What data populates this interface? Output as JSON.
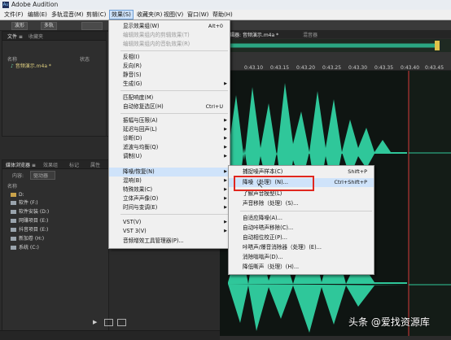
{
  "window": {
    "title": "Adobe Audition",
    "app_icon": "Au"
  },
  "menubar": [
    "文件(F)",
    "编辑(E)",
    "多轨混音(M)",
    "剪辑(C)",
    "效果(S)",
    "收藏夹(R)",
    "视图(V)",
    "窗口(W)",
    "帮助(H)"
  ],
  "toolbar": {
    "waveform": "波形",
    "multitrack": "多轨"
  },
  "files_panel": {
    "tabs": [
      "文件 ≡",
      "收藏夹"
    ],
    "columns": {
      "name": "名称",
      "status": "状态",
      "duration": "持续时间"
    },
    "items": [
      "音频演示.m4a *"
    ]
  },
  "media_panel": {
    "tabs": [
      "媒体浏览器 ≡",
      "效果组",
      "标记",
      "属性"
    ],
    "content_label": "内容:",
    "content_value": "驱动器",
    "name_col": "名称",
    "drives": [
      "D:",
      "软件 (F:)",
      "软件安装 (D:)",
      "网赚项目 (E:)",
      "抖音项目 (E:)",
      "新加卷 (H:)",
      "系统 (C:)"
    ]
  },
  "editor": {
    "tab": "编辑器: 音频演示.m4a *",
    "tab2": "混音器"
  },
  "ruler": [
    "0:43.10",
    "0:43.15",
    "0:43.20",
    "0:43.25",
    "0:43.30",
    "0:43.35",
    "0:43.40",
    "0:43.45"
  ],
  "effects_menu": {
    "items": [
      {
        "label": "显示效果组(W)",
        "shortcut": "Alt+0"
      },
      {
        "label": "编辑效果组内的剪辑效果(T)",
        "disabled": true
      },
      {
        "label": "编辑效果组内的音轨效果(R)",
        "disabled": true
      },
      {
        "label": "反相(I)"
      },
      {
        "label": "反向(R)"
      },
      {
        "label": "静音(S)"
      },
      {
        "label": "生成(G)",
        "arrow": true
      },
      {
        "label": "匹配响度(M)"
      },
      {
        "label": "自动修复选区(H)",
        "shortcut": "Ctrl+U"
      },
      {
        "label": "振幅与压限(A)",
        "arrow": true
      },
      {
        "label": "延迟与回声(L)",
        "arrow": true
      },
      {
        "label": "诊断(D)",
        "arrow": true
      },
      {
        "label": "滤波与均衡(Q)",
        "arrow": true
      },
      {
        "label": "调制(U)",
        "arrow": true
      },
      {
        "label": "降噪/恢复(N)",
        "arrow": true,
        "highlight": true
      },
      {
        "label": "混响(B)",
        "arrow": true
      },
      {
        "label": "特殊效果(C)",
        "arrow": true
      },
      {
        "label": "立体声声像(O)",
        "arrow": true
      },
      {
        "label": "时间与变调(E)",
        "arrow": true
      },
      {
        "label": "VST(V)",
        "arrow": true
      },
      {
        "label": "VST 3(V)",
        "arrow": true
      },
      {
        "label": "音频增效工具管理器(P)..."
      }
    ]
  },
  "noise_submenu": {
    "items": [
      {
        "label": "捕捉噪声样本(C)",
        "shortcut": "Shift+P"
      },
      {
        "label": "降噪（处理）(N)...",
        "shortcut": "Ctrl+Shift+P",
        "highlight": true
      },
      {
        "label": "了解声音模型(L)"
      },
      {
        "label": "声音移除（处理）(S)..."
      },
      {
        "label": "自适应降噪(A)..."
      },
      {
        "label": "自动咔嗒声移除(C)..."
      },
      {
        "label": "自动相位校正(P)..."
      },
      {
        "label": "咔嗒声/爆音消除器（处理）(E)..."
      },
      {
        "label": "消除嗡嗡声(D)..."
      },
      {
        "label": "降低嘶声（处理）(H)..."
      }
    ]
  },
  "watermark": "头条 @爱找资源库",
  "colors": {
    "waveform": "#2fc79a",
    "menu_highlight": "#cfe3fa",
    "callout": "#e0271f"
  }
}
